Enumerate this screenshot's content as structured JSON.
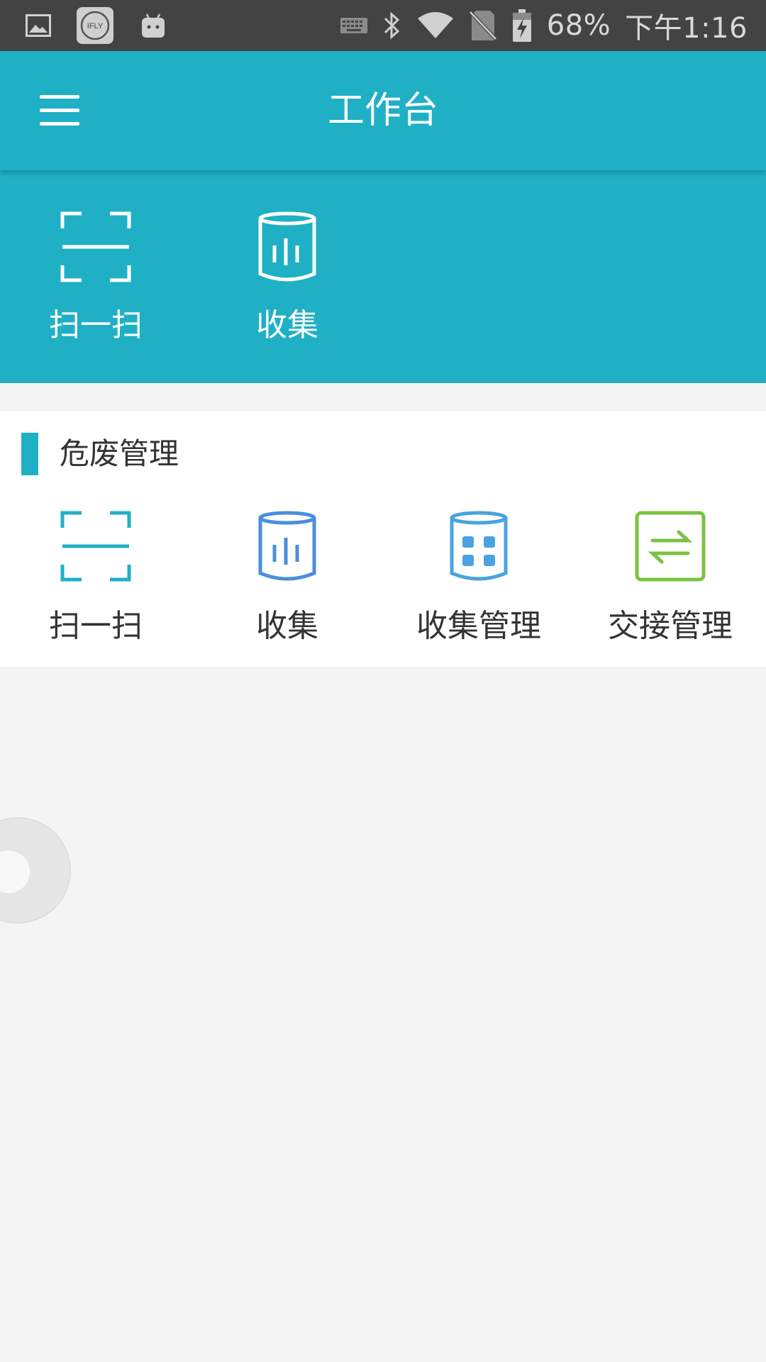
{
  "status_bar": {
    "battery_text": "68%",
    "time": "下午1:16",
    "left_icons": [
      "image-icon",
      "ifly-icon",
      "android-icon"
    ],
    "right_icons": [
      "keyboard-icon",
      "bluetooth-icon",
      "wifi-icon",
      "no-sim-icon",
      "battery-charging-icon"
    ],
    "ifly_label": "IFLY"
  },
  "app_bar": {
    "title": "工作台",
    "menu_icon": "menu-icon"
  },
  "header_shortcuts": [
    {
      "label": "扫一扫",
      "icon": "scan-icon"
    },
    {
      "label": "收集",
      "icon": "collect-icon"
    }
  ],
  "section": {
    "title": "危废管理",
    "items": [
      {
        "label": "扫一扫",
        "icon": "scan-icon",
        "color": "#1fb0c6"
      },
      {
        "label": "收集",
        "icon": "collect-icon",
        "color": "#4a8fdc"
      },
      {
        "label": "收集管理",
        "icon": "collect-manage-icon",
        "color": "#4aa3e0"
      },
      {
        "label": "交接管理",
        "icon": "transfer-icon",
        "color": "#7cc242"
      }
    ]
  },
  "colors": {
    "primary": "#1fb0c6",
    "status_bar": "#434343",
    "background": "#f4f4f4"
  }
}
